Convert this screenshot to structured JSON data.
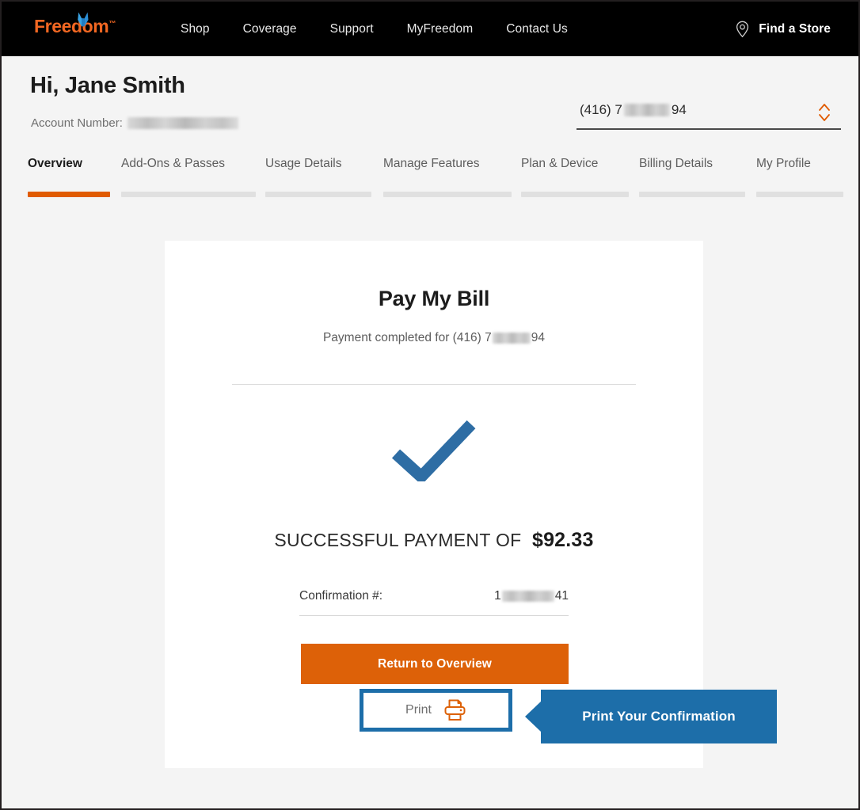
{
  "header": {
    "logo_text": "Freedom",
    "logo_tm": "™",
    "logo_bird_icon": "bird-wing-icon",
    "nav_links": [
      {
        "label": "Shop"
      },
      {
        "label": "Coverage"
      },
      {
        "label": "Support"
      },
      {
        "label": "MyFreedom"
      },
      {
        "label": "Contact Us"
      }
    ],
    "find_store": {
      "label": "Find a Store",
      "icon": "location-pin-icon"
    },
    "background_color": "#000000"
  },
  "account": {
    "greeting": "Hi, Jane Smith",
    "account_number_label": "Account Number:",
    "account_number_value": "",
    "account_number_redacted": true
  },
  "phone_selector": {
    "value_prefix": "(416) 7",
    "value_suffix": "94",
    "value_redacted": true,
    "spinner_icon": "up-down-chevron-icon",
    "spinner_color": "#e05a00"
  },
  "tabs": {
    "active_index": 0,
    "accent_color": "#e05a00",
    "items": [
      {
        "label": "Overview"
      },
      {
        "label": "Add-Ons & Passes"
      },
      {
        "label": "Usage Details"
      },
      {
        "label": "Manage Features"
      },
      {
        "label": "Plan & Device"
      },
      {
        "label": "Billing Details"
      },
      {
        "label": "My Profile"
      }
    ]
  },
  "card": {
    "title": "Pay My Bill",
    "subtitle_prefix": "Payment completed for (416) 7",
    "subtitle_suffix": "94",
    "check_icon": "blue-checkmark-icon",
    "check_color": "#2e6da4",
    "success_label": "SUCCESSFUL PAYMENT OF",
    "success_amount": "$92.33",
    "confirmation_label": "Confirmation #:",
    "confirmation_prefix": "1",
    "confirmation_suffix": "41",
    "primary_button": {
      "label": "Return to Overview",
      "color": "#dd6108"
    },
    "print_button": {
      "label": "Print",
      "icon": "printer-icon",
      "icon_color": "#dd6108"
    }
  },
  "annotation": {
    "text": "Print Your Confirmation",
    "color": "#1d6ea9",
    "highlight_target": "print-button"
  }
}
